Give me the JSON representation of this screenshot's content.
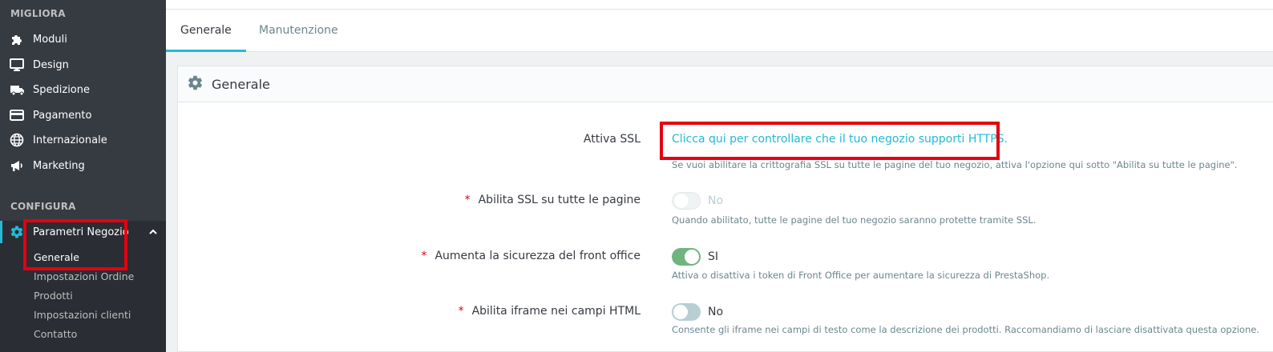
{
  "sidebar": {
    "section_migliora": "MIGLIORA",
    "items_migliora": [
      {
        "label": "Moduli",
        "icon": "puzzle-icon"
      },
      {
        "label": "Design",
        "icon": "monitor-icon"
      },
      {
        "label": "Spedizione",
        "icon": "truck-icon"
      },
      {
        "label": "Pagamento",
        "icon": "credit-card-icon"
      },
      {
        "label": "Internazionale",
        "icon": "globe-icon"
      },
      {
        "label": "Marketing",
        "icon": "megaphone-icon"
      }
    ],
    "section_configura": "CONFIGURA",
    "active_item": {
      "label": "Parametri Negozio",
      "icon": "gear-icon"
    },
    "sub_items": [
      "Generale",
      "Impostazioni Ordine",
      "Prodotti",
      "Impostazioni clienti",
      "Contatto"
    ]
  },
  "tabs": [
    "Generale",
    "Manutenzione"
  ],
  "card": {
    "title": "Generale",
    "rows": {
      "ssl": {
        "label": "Attiva SSL",
        "link": "Clicca qui per controllare che il tuo negozio supporti HTTPS.",
        "help": "Se vuoi abilitare la crittografia SSL su tutte le pagine del tuo negozio, attiva l'opzione qui sotto \"Abilita su tutte le pagine\"."
      },
      "ssl_all": {
        "required": "*",
        "label": "Abilita SSL su tutte le pagine",
        "value": "No",
        "help": "Quando abilitato, tutte le pagine del tuo negozio saranno protette tramite SSL."
      },
      "front_security": {
        "required": "*",
        "label": "Aumenta la sicurezza del front office",
        "value": "SI",
        "help": "Attiva o disattiva i token di Front Office per aumentare la sicurezza di PrestaShop."
      },
      "iframe": {
        "required": "*",
        "label": "Abilita iframe nei campi HTML",
        "value": "No",
        "help": "Consente gli iframe nei campi di testo come la descrizione dei prodotti. Raccomandiamo di lasciare disattivata questa opzione."
      }
    }
  },
  "colors": {
    "accent": "#25b9d7",
    "highlight": "#e4000f",
    "switch_on": "#70b580"
  }
}
